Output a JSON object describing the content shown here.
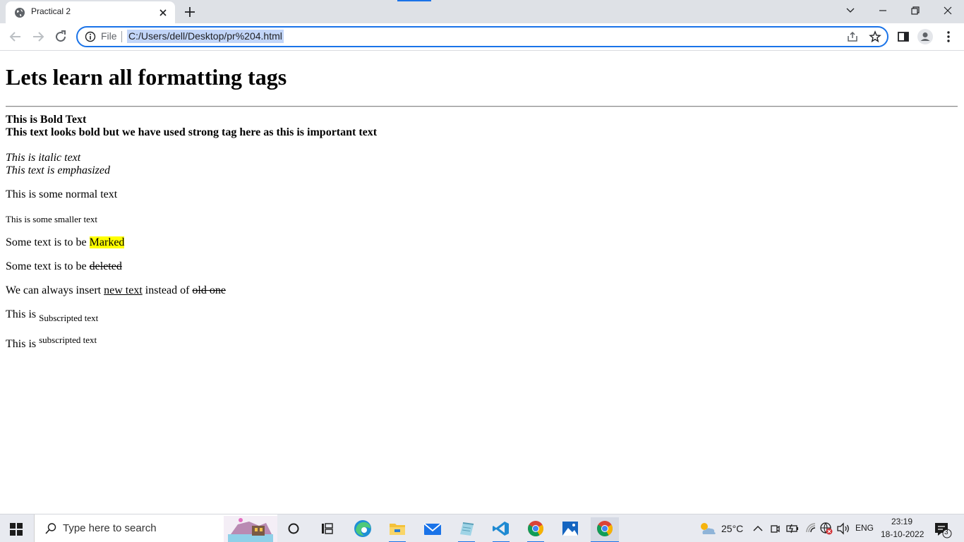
{
  "browser": {
    "tab_title": "Practical 2",
    "address_scheme_label": "File",
    "address_url": "C:/Users/dell/Desktop/pr%204.html"
  },
  "page": {
    "heading": "Lets learn all formatting tags",
    "bold_text": "This is Bold Text",
    "strong_text": "This text looks bold but we have used strong tag here as this is important text",
    "italic_text": "This is italic text",
    "em_text": "This text is emphasized",
    "normal_text": "This is some normal text",
    "small_text": "This is some smaller text",
    "mark_prefix": "Some text is to be ",
    "mark_word": "Marked",
    "del_prefix": "Some text is to be ",
    "del_word": "deleted",
    "ins_prefix": "We can always insert ",
    "ins_word": "new text",
    "ins_middle": " instead of ",
    "ins_old": "old one",
    "sub_prefix": "This is ",
    "sub_word": "Subscripted text",
    "sup_prefix": "This is ",
    "sup_word": "subscripted text"
  },
  "taskbar": {
    "search_placeholder": "Type here to search",
    "apps": [
      "task-view",
      "cortana",
      "edge",
      "file-explorer",
      "mail",
      "notepad",
      "vscode",
      "chrome",
      "photos",
      "chrome"
    ],
    "weather_temp": "25°C",
    "language": "ENG",
    "time": "23:19",
    "date": "18-10-2022",
    "notification_count": "3"
  },
  "colors": {
    "accent": "#1a73e8",
    "mark_highlight": "#ffff00",
    "url_selection": "#c2d5f8"
  }
}
